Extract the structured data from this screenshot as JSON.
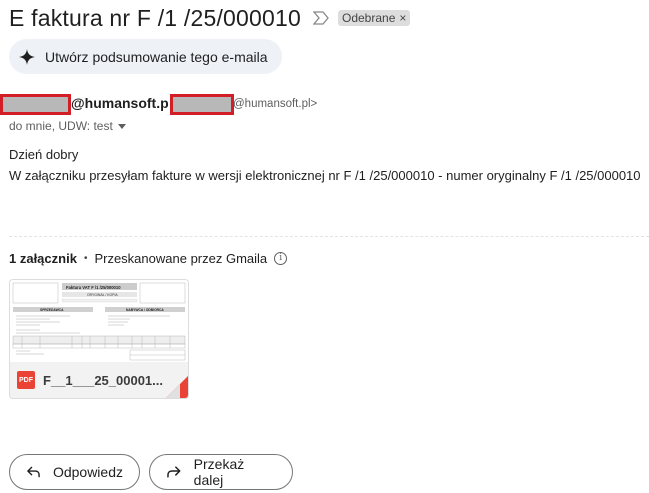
{
  "email": {
    "subject": "E faktura nr F /1 /25/000010",
    "label": "Odebrane",
    "label_remove": "×",
    "summary_button": "Utwórz podsumowanie tego e-maila",
    "sender_name": "@humansoft.p",
    "sender_email": "@humansoft.pl>",
    "recipients": "do mnie, UDW: test",
    "body": {
      "greeting": "Dzień dobry",
      "line": "W załączniku przesyłam fakture w wersji elektronicznej nr F /1 /25/000010 - numer oryginalny F /1 /25/000010"
    }
  },
  "attachments": {
    "count_label": "1 załącznik",
    "separator": "•",
    "scan_label": "Przeskanowane przez Gmaila",
    "info_glyph": "i",
    "items": [
      {
        "file_name": "F__1___25_00001...",
        "type_badge": "PDF",
        "thumb_title": "Faktura VAT  F /1 /25/000010",
        "thumb_subtitle": "ORYGINAŁ / KOPIA",
        "thumb_seller": "SPRZEDAWCA",
        "thumb_buyer": "NABYWCA / ODBIORCA"
      }
    ]
  },
  "actions": {
    "reply": "Odpowiedz",
    "forward": "Przekaż dalej"
  },
  "colors": {
    "redaction_border": "#d21f26",
    "pdf_red": "#ea4335",
    "summary_bg": "#eef2f7"
  },
  "icons": [
    "importance-icon",
    "sparkle-icon",
    "chevron-down-icon",
    "info-icon",
    "pdf-icon",
    "reply-icon",
    "forward-icon"
  ]
}
